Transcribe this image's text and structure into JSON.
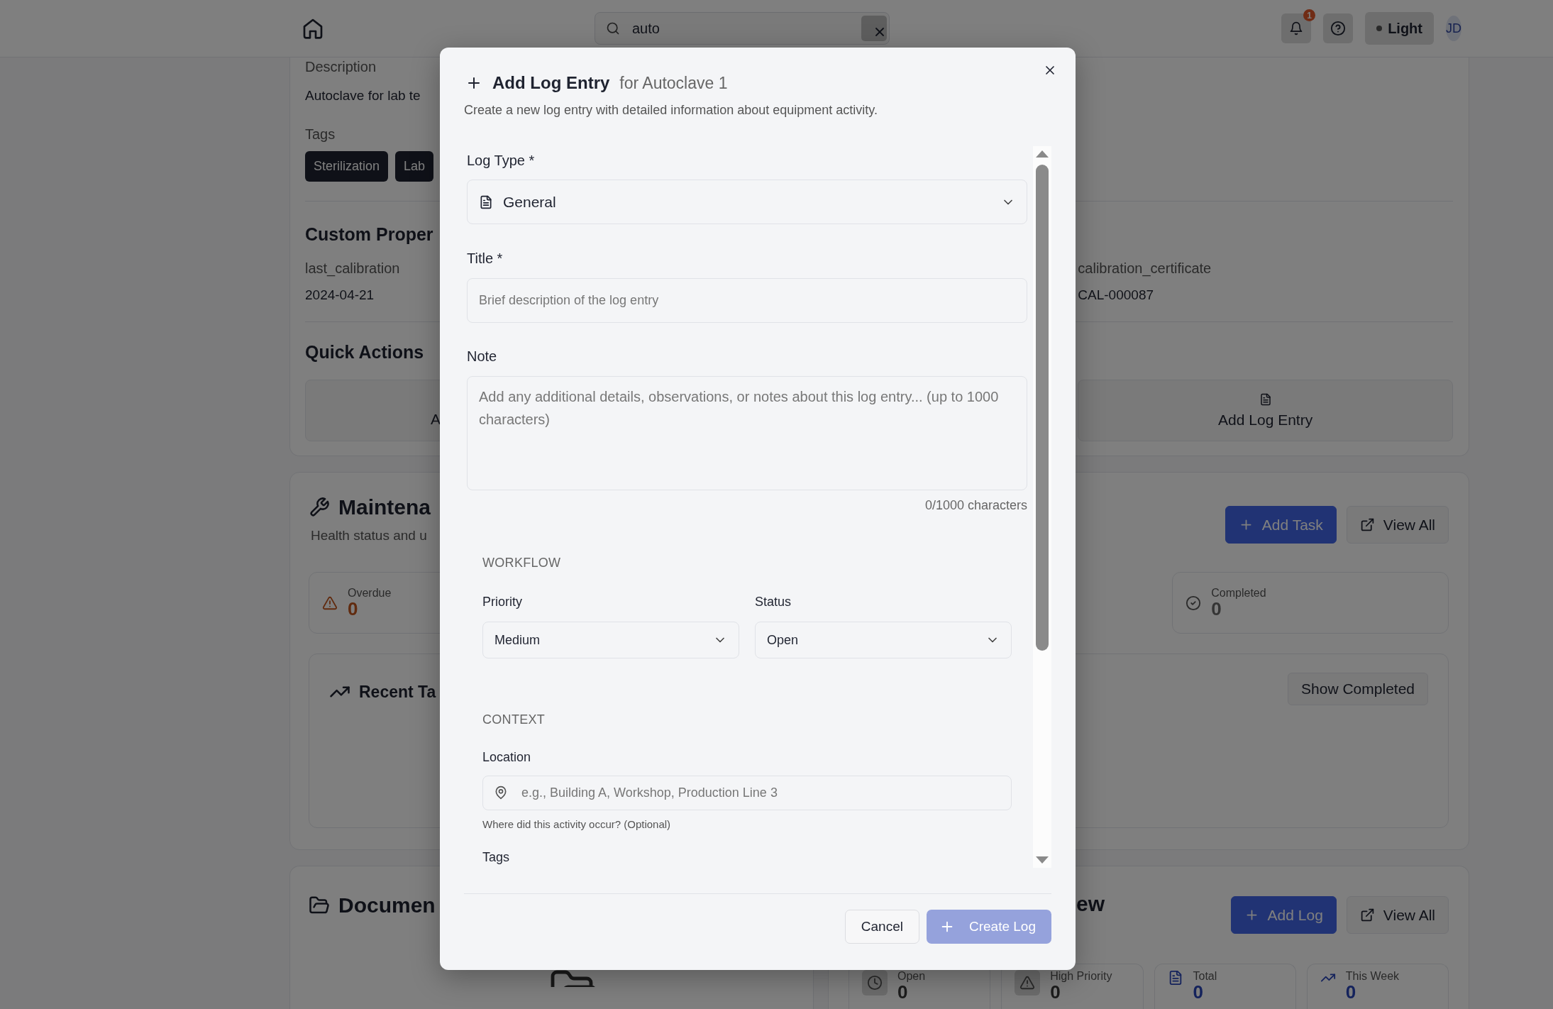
{
  "top_bar": {
    "search": {
      "value": "auto"
    },
    "notifications": {
      "count": "1"
    },
    "theme_toggle": {
      "label": "Light"
    },
    "avatar": {
      "initials": "JD"
    }
  },
  "equipment_details": {
    "description_label": "Description",
    "description": "Autoclave for lab te",
    "tags_label": "Tags",
    "tags": [
      "Sterilization",
      "Lab"
    ],
    "custom_properties_title": "Custom Proper",
    "properties": [
      {
        "name": "last_calibration",
        "value": "2024-04-21"
      },
      {
        "name": "calibration_certificate",
        "value": "CAL-000087"
      }
    ],
    "quick_actions_title": "Quick Actions",
    "quick_actions": [
      {
        "label": "A",
        "kind": "cut"
      },
      {
        "label": "Add Log Entry",
        "kind": "document"
      }
    ]
  },
  "maintenance": {
    "title": "Maintena",
    "subtitle": "Health status and u",
    "buttons": [
      {
        "label": "Add Task",
        "kind": "primary"
      },
      {
        "label": "View All",
        "kind": "outline"
      }
    ],
    "stats": [
      {
        "label": "Overdue",
        "value": "0",
        "kind": "warning"
      },
      {
        "label": "Completed",
        "value": "0",
        "kind": "check"
      }
    ],
    "recent_tasks": {
      "title": "Recent Ta",
      "button": "Show Completed"
    }
  },
  "documents": {
    "title": "Documen"
  },
  "logs": {
    "title": "ew",
    "buttons": [
      {
        "label": "Add Log",
        "kind": "primary"
      },
      {
        "label": "View All",
        "kind": "outline"
      }
    ],
    "stats": [
      {
        "label": "Open",
        "value": "0",
        "kind": "clock"
      },
      {
        "label": "High Priority",
        "value": "0",
        "kind": "warning"
      },
      {
        "label": "Total",
        "value": "0",
        "kind": "document"
      },
      {
        "label": "This Week",
        "value": "0",
        "kind": "trend"
      }
    ]
  },
  "dialog": {
    "title": "Add Log Entry",
    "subtitle": "for Autoclave 1",
    "description": "Create a new log entry with detailed information about equipment activity.",
    "log_type": {
      "label": "Log Type *",
      "value": "General"
    },
    "title_field": {
      "label": "Title *",
      "placeholder": "Brief description of the log entry"
    },
    "note": {
      "label": "Note",
      "placeholder": "Add any additional details, observations, or notes about this log entry... (up to 1000 characters)",
      "counter": "0/1000 characters"
    },
    "workflow": {
      "heading": "WORKFLOW",
      "priority": {
        "label": "Priority",
        "value": "Medium"
      },
      "status": {
        "label": "Status",
        "value": "Open"
      }
    },
    "context": {
      "heading": "CONTEXT",
      "location": {
        "label": "Location",
        "placeholder": "e.g., Building A, Workshop, Production Line 3",
        "hint": "Where did this activity occur? (Optional)"
      },
      "tags_label": "Tags"
    },
    "cancel_button": "Cancel",
    "create_button": {
      "label": "Create Log",
      "disabled": true
    }
  }
}
